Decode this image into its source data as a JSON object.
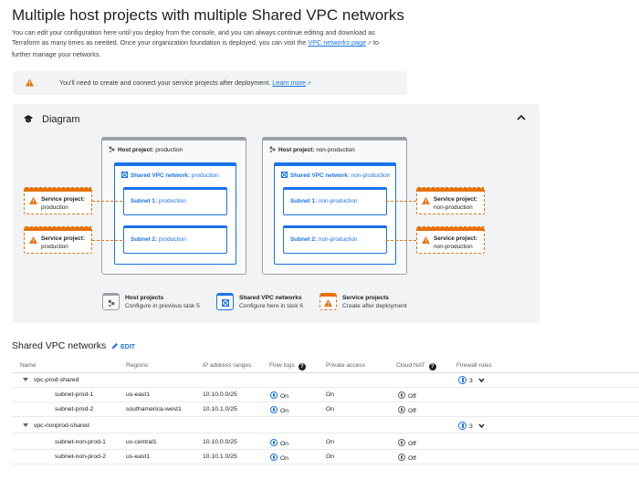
{
  "page": {
    "title": "Multiple host projects with multiple Shared VPC networks",
    "intro_1": "You can edit your configuration here until you deploy from the console, and you can always continue editing and download as Terraform as many times as needed. Once your organization foundation is deployed, you can visit the ",
    "intro_link": "VPC networks page",
    "intro_2": " to further manage your networks."
  },
  "notice": {
    "text": "You'll need to create and connect your service projects after deployment.",
    "link": "Learn more"
  },
  "diagram": {
    "title": "Diagram",
    "hosts": [
      {
        "label": "Host project:",
        "name": "production",
        "vpc_label": "Shared VPC network:",
        "vpc_name": "production",
        "subnets": [
          {
            "label": "Subnet 1:",
            "name": "production"
          },
          {
            "label": "Subnet 2:",
            "name": "production"
          }
        ]
      },
      {
        "label": "Host project:",
        "name": "non-production",
        "vpc_label": "Shared VPC network:",
        "vpc_name": "non-production",
        "subnets": [
          {
            "label": "Subnet 1:",
            "name": "non-production"
          },
          {
            "label": "Subnet 2:",
            "name": "non-production"
          }
        ]
      }
    ],
    "service_left": [
      {
        "label": "Service project:",
        "name": "production"
      },
      {
        "label": "Service project:",
        "name": "production"
      }
    ],
    "service_right": [
      {
        "label": "Service project:",
        "name": "non-production"
      },
      {
        "label": "Service project:",
        "name": "non-production"
      }
    ],
    "legend": [
      {
        "title": "Host projects",
        "desc": "Configure in previous task 5"
      },
      {
        "title": "Shared VPC networks",
        "desc": "Configure here in task 6"
      },
      {
        "title": "Service projects",
        "desc": "Create after deployment"
      }
    ]
  },
  "shared_vpc": {
    "title": "Shared VPC networks",
    "edit_label": "EDIT",
    "columns": [
      "Name",
      "Regions",
      "IP address ranges",
      "Flow logs",
      "Private access",
      "Cloud NAT",
      "Firewall rules"
    ],
    "groups": [
      {
        "name": "vpc-prod-shared",
        "firewall_count": "3",
        "rows": [
          {
            "name": "subnet-prod-1",
            "region": "us-east1",
            "ip": "10.10.0.0/25",
            "flow": "On",
            "private": "On",
            "nat": "Off"
          },
          {
            "name": "subnet-prod-2",
            "region": "southamerica-west1",
            "ip": "10.10.1.0/25",
            "flow": "On",
            "private": "On",
            "nat": "Off"
          }
        ]
      },
      {
        "name": "vpc-nonprod-shared",
        "firewall_count": "3",
        "rows": [
          {
            "name": "subnet-non-prod-1",
            "region": "us-central1",
            "ip": "10.10.0.0/25",
            "flow": "On",
            "private": "On",
            "nat": "Off"
          },
          {
            "name": "subnet-non-prod-2",
            "region": "us-east1",
            "ip": "10.10.1.0/25",
            "flow": "On",
            "private": "On",
            "nat": "Off"
          }
        ]
      }
    ]
  },
  "colors": {
    "accent": "#1a73e8",
    "warning": "#e8710a",
    "host_border": "#9aa0a6",
    "panel_bg": "#f1f3f4"
  },
  "icons": [
    "warning-icon",
    "graduation-cap-icon",
    "chevron-up-icon",
    "host-project-icon",
    "shared-vpc-icon",
    "edit-pencil-icon",
    "help-icon",
    "flow-log-icon",
    "firewall-badge-icon",
    "chevron-down-icon",
    "external-link-icon"
  ]
}
